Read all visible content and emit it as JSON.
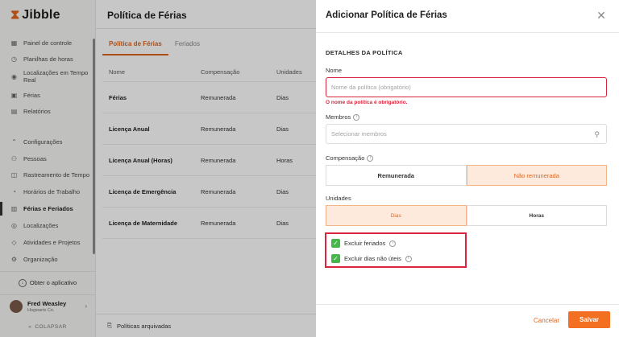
{
  "app": {
    "name": "Jibble"
  },
  "sidebar": {
    "items": [
      {
        "label": "Painel de controle",
        "icon": "dashboard-icon"
      },
      {
        "label": "Planilhas de horas",
        "icon": "clock-icon"
      },
      {
        "label": "Localizações em Tempo Real",
        "icon": "location-pin-icon"
      },
      {
        "label": "Férias",
        "icon": "suitcase-icon"
      },
      {
        "label": "Relatórios",
        "icon": "report-icon"
      },
      {
        "label": "Configurações",
        "icon": "chevron-up-icon"
      },
      {
        "label": "Pessoas",
        "icon": "people-icon"
      },
      {
        "label": "Rastreamento de Tempo",
        "icon": "time-tracking-icon"
      },
      {
        "label": "Horários de Trabalho",
        "icon": "schedule-icon"
      },
      {
        "label": "Férias e Feriados",
        "icon": "calendar-icon"
      },
      {
        "label": "Localizações",
        "icon": "map-icon"
      },
      {
        "label": "Atividades e Projetos",
        "icon": "tag-icon"
      },
      {
        "label": "Organização",
        "icon": "gear-icon"
      }
    ],
    "get_app": "Obter o aplicativo",
    "user": {
      "name": "Fred Weasley",
      "org": "Hogwarts Co."
    },
    "collapse": "COLAPSAR"
  },
  "main": {
    "title": "Política de Férias",
    "tabs": [
      {
        "label": "Política de Férias"
      },
      {
        "label": "Feriados"
      }
    ],
    "table": {
      "headers": [
        "Nome",
        "Compensação",
        "Unidades"
      ],
      "rows": [
        [
          "Férias",
          "Remunerada",
          "Dias"
        ],
        [
          "Licença Anual",
          "Remunerada",
          "Dias"
        ],
        [
          "Licença Anual (Horas)",
          "Remunerada",
          "Horas"
        ],
        [
          "Licença de Emergência",
          "Remunerada",
          "Dias"
        ],
        [
          "Licença de Maternidade",
          "Remunerada",
          "Dias"
        ]
      ]
    },
    "archived": "Políticas arquivadas"
  },
  "drawer": {
    "title": "Adicionar Política de Férias",
    "section": "DETALHES DA POLÍTICA",
    "name": {
      "label": "Nome",
      "placeholder": "Nome da política (obrigatório)",
      "error": "O nome da política é obrigatório."
    },
    "members": {
      "label": "Membros",
      "placeholder": "Selecionar membros"
    },
    "compensation": {
      "label": "Compensação",
      "options": [
        "Remunerada",
        "Não remunerada"
      ],
      "selected": "Não remunerada"
    },
    "units": {
      "label": "Unidades",
      "options": [
        "Dias",
        "Horas"
      ],
      "selected": "Dias"
    },
    "checks": [
      {
        "label": "Excluir feriados",
        "checked": true
      },
      {
        "label": "Excluir dias não úteis",
        "checked": true
      }
    ],
    "cancel": "Cancelar",
    "save": "Salvar"
  },
  "colors": {
    "accent": "#f36f21",
    "error": "#d7263d",
    "check": "#45b649",
    "selected_bg": "#fdeadc"
  }
}
